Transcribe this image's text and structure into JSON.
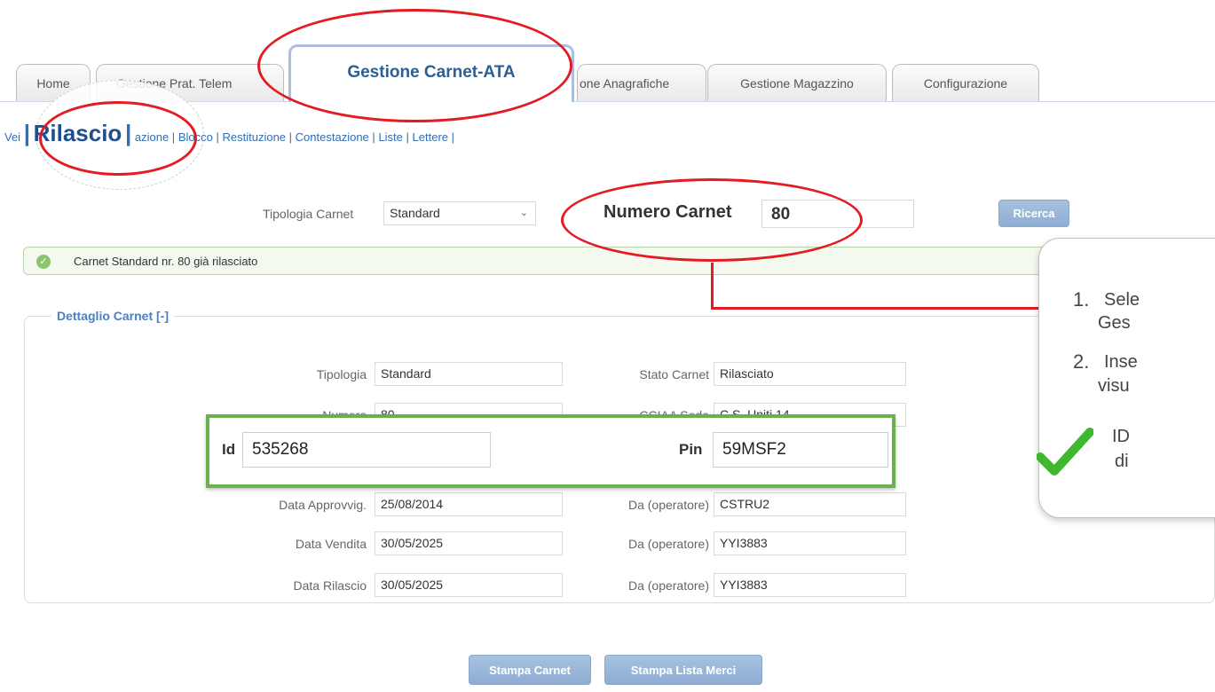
{
  "tabs": [
    {
      "label": "Home"
    },
    {
      "label": "Gestione Prat. Telem"
    },
    {
      "label": "Gestione Carnet-ATA"
    },
    {
      "label": "one Anagrafiche"
    },
    {
      "label": "Gestione Magazzino"
    },
    {
      "label": "Configurazione"
    }
  ],
  "submenu": {
    "item0": "Vei",
    "sep": "|",
    "active": "Rilascio",
    "item2": "azione",
    "item3": "Blocco",
    "item4": "Restituzione",
    "item5": "Contestazione",
    "item6": "Liste",
    "item7": "Lettere"
  },
  "search": {
    "tipologia_label": "Tipologia Carnet",
    "tipologia_value": "Standard",
    "numero_label": "Numero Carnet",
    "numero_value": "80",
    "ricerca_button": "Ricerca"
  },
  "status": {
    "message": "Carnet Standard nr. 80 già rilasciato",
    "color": "#8cc470"
  },
  "detail": {
    "legend": "Dettaglio Carnet [-]",
    "rows": [
      {
        "left_label": "Tipologia",
        "left_value": "Standard",
        "right_label": "Stato Carnet",
        "right_value": "Rilasciato"
      },
      {
        "left_label": "Numero",
        "left_value": "80",
        "right_label": "CCIAA Sede",
        "right_value": "C.S. Uniti 14"
      },
      {
        "left_label": "Data Approvvig.",
        "left_value": "25/08/2014",
        "right_label": "Da (operatore)",
        "right_value": "CSTRU2"
      },
      {
        "left_label": "Data Vendita",
        "left_value": "30/05/2025",
        "right_label": "Da (operatore)",
        "right_value": "YYI3883"
      },
      {
        "left_label": "Data Rilascio",
        "left_value": "30/05/2025",
        "right_label": "Da (operatore)",
        "right_value": "YYI3883"
      }
    ]
  },
  "highlight": {
    "id_label": "Id",
    "id_value": "535268",
    "pin_label": "Pin",
    "pin_value": "59MSF2"
  },
  "callout": {
    "line1a": "1.",
    "line1b": "Sele",
    "line1c": "Ges",
    "line2a": "2.",
    "line2b": "Inse",
    "line2c": "visu",
    "line3a": "ID",
    "line3b": "di"
  },
  "buttons": {
    "stampa_carnet": "Stampa Carnet",
    "stampa_lista": "Stampa Lista Merci"
  },
  "colors": {
    "accent_red": "#e31b23",
    "accent_green": "#6ab04c",
    "link_blue": "#2f6fb6"
  }
}
